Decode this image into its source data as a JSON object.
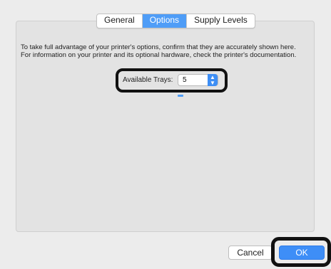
{
  "tabs": [
    "General",
    "Options",
    "Supply Levels"
  ],
  "active_tab": "Options",
  "description": "To take full advantage of your printer's options, confirm that they are accurately shown here. For information on your printer and its optional hardware, check the printer's documentation.",
  "trays": {
    "label": "Available Trays:",
    "value": "5"
  },
  "buttons": {
    "cancel": "Cancel",
    "ok": "OK"
  },
  "colors": {
    "accent": "#4f9df7",
    "highlight_outline": "#111111"
  }
}
